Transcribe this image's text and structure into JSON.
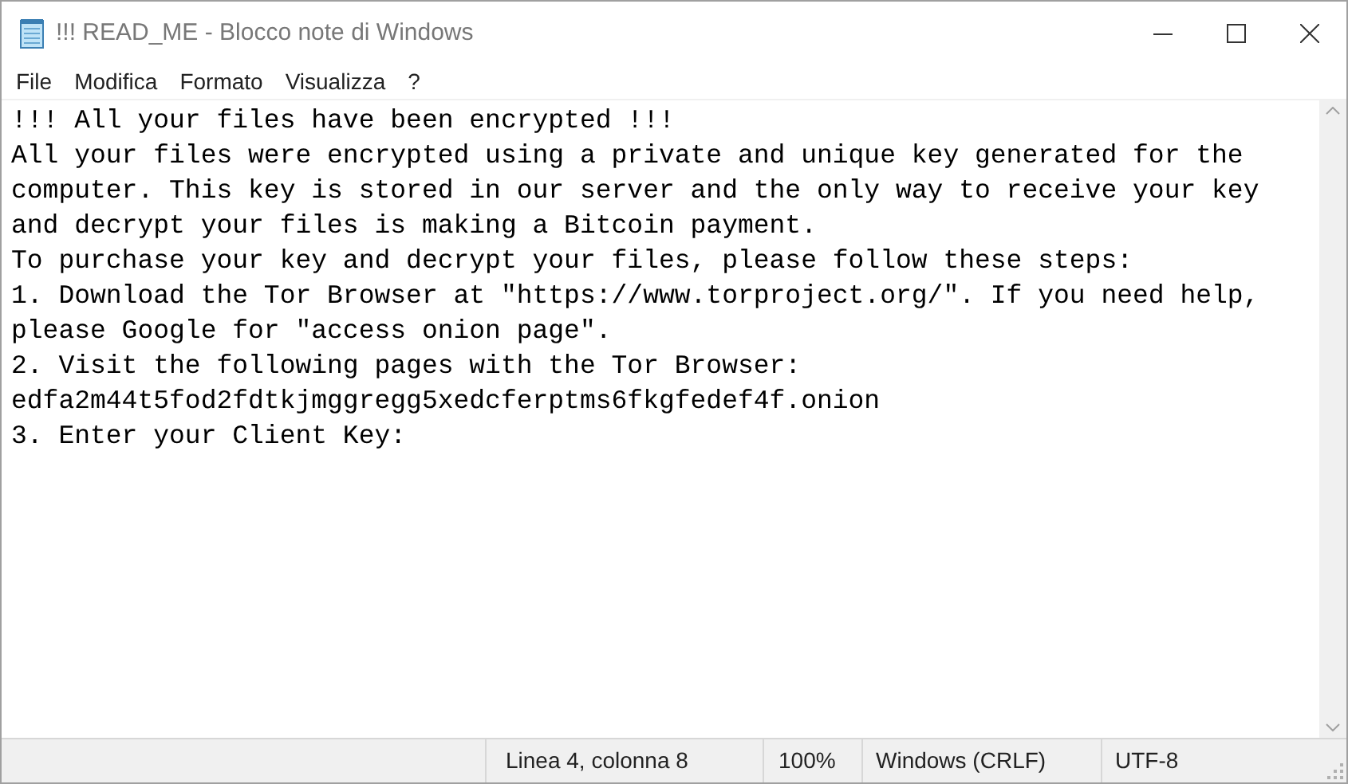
{
  "window": {
    "title": "!!! READ_ME - Blocco note di Windows"
  },
  "menu": [
    "File",
    "Modifica",
    "Formato",
    "Visualizza",
    "?"
  ],
  "document": {
    "lines": [
      "!!! All your files have been encrypted !!!",
      "All your files were encrypted using a private and unique key generated for the",
      "computer. This key is stored in our server and the only way to receive your key",
      "and decrypt your files is making a Bitcoin payment.",
      "To purchase your key and decrypt your files, please follow these steps:",
      "1. Download the Tor Browser at \"https://www.torproject.org/\". If you need help,",
      "please Google for \"access onion page\".",
      "2. Visit the following pages with the Tor Browser:",
      "edfa2m44t5fod2fdtkjmggregg5xedcferptms6fkgfedef4f.onion",
      "3. Enter your Client Key:"
    ]
  },
  "status_bar": {
    "position": "Linea 4, colonna 8",
    "zoom": "100%",
    "line_endings": "Windows (CRLF)",
    "encoding": "UTF-8"
  }
}
